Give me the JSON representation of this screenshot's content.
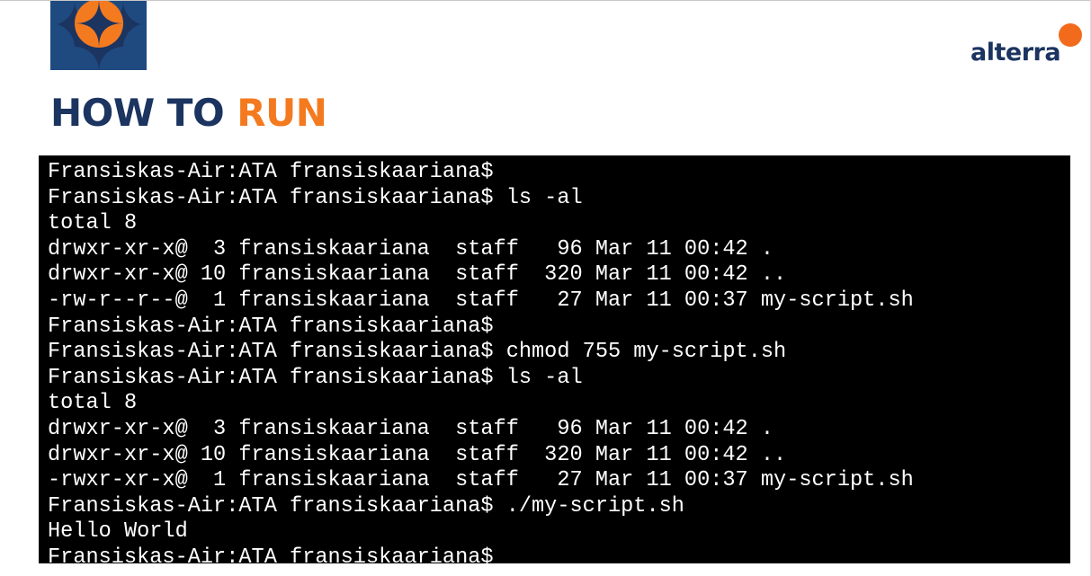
{
  "colors": {
    "navy": "#1b3460",
    "orange": "#f47a20",
    "terminal_bg": "#000000"
  },
  "brand": {
    "name": "alterra"
  },
  "title": {
    "part1": "HOW TO ",
    "part2": "RUN"
  },
  "terminal": {
    "lines": [
      "Fransiskas-Air:ATA fransiskaariana$",
      "Fransiskas-Air:ATA fransiskaariana$ ls -al",
      "total 8",
      "drwxr-xr-x@  3 fransiskaariana  staff   96 Mar 11 00:42 .",
      "drwxr-xr-x@ 10 fransiskaariana  staff  320 Mar 11 00:42 ..",
      "-rw-r--r--@  1 fransiskaariana  staff   27 Mar 11 00:37 my-script.sh",
      "Fransiskas-Air:ATA fransiskaariana$",
      "Fransiskas-Air:ATA fransiskaariana$ chmod 755 my-script.sh",
      "Fransiskas-Air:ATA fransiskaariana$ ls -al",
      "total 8",
      "drwxr-xr-x@  3 fransiskaariana  staff   96 Mar 11 00:42 .",
      "drwxr-xr-x@ 10 fransiskaariana  staff  320 Mar 11 00:42 ..",
      "-rwxr-xr-x@  1 fransiskaariana  staff   27 Mar 11 00:37 my-script.sh",
      "Fransiskas-Air:ATA fransiskaariana$ ./my-script.sh",
      "Hello World",
      "Fransiskas-Air:ATA fransiskaariana$"
    ]
  }
}
